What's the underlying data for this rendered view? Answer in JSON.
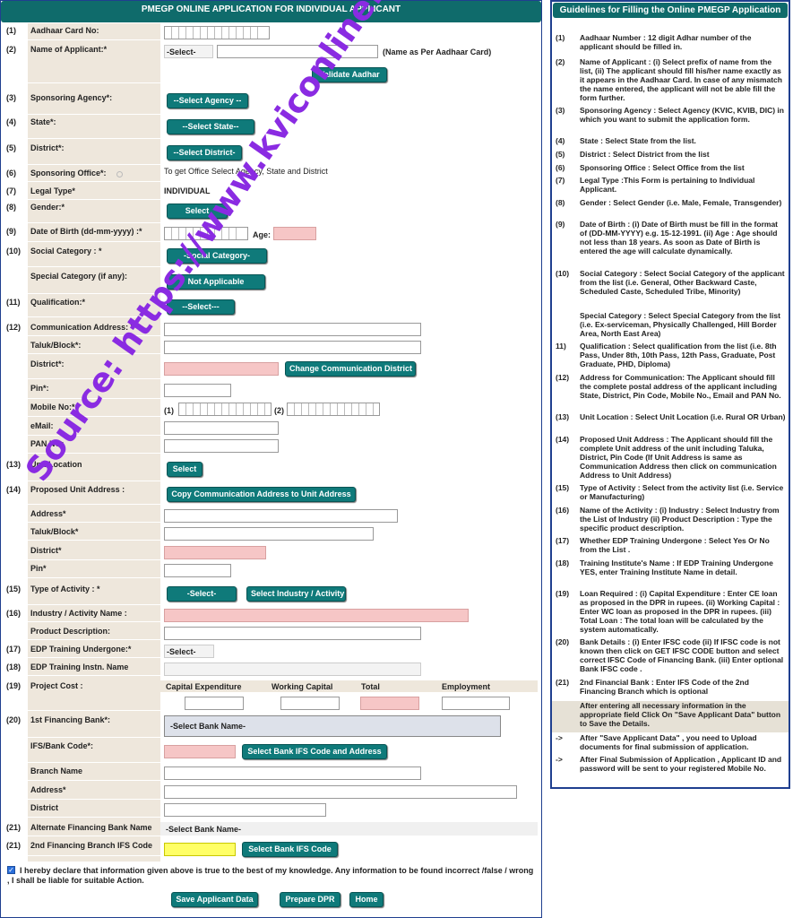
{
  "left": {
    "title": "PMEGP ONLINE APPLICATION FOR INDIVIDUAL APPLICANT",
    "rows": [
      {
        "n": "(1)",
        "label": "Aadhaar Card No:"
      },
      {
        "n": "(2)",
        "label": "Name of Applicant:*",
        "select": "-Select-",
        "note": "(Name as Per Aadhaar Card)"
      },
      {
        "n": "(3)",
        "label": "Sponsoring Agency*:",
        "select": "--Select Agency --"
      },
      {
        "n": "(4)",
        "label": "State*:",
        "select": "--Select State--"
      },
      {
        "n": "(5)",
        "label": "District*:",
        "select": "--Select District-"
      },
      {
        "n": "(6)",
        "label": "Sponsoring Office*:",
        "note": "To get Office Select Agency, State and District"
      },
      {
        "n": "(7)",
        "label": "Legal Type*",
        "value": "INDIVIDUAL"
      },
      {
        "n": "(8)",
        "label": "Gender:*",
        "select": "Select"
      },
      {
        "n": "(9)",
        "label": "Date of Birth (dd-mm-yyyy) :*",
        "age": "Age:"
      },
      {
        "n": "(10)",
        "label": "Social Category : *",
        "select": "-Social Category-"
      },
      {
        "n": "",
        "label": "Special Category (if any):",
        "select": "Not Applicable"
      },
      {
        "n": "(11)",
        "label": "Qualification:*",
        "select": "--Select---"
      },
      {
        "n": "(12)",
        "label": "Communication Address: *"
      },
      {
        "n": "",
        "label": "Taluk/Block*:"
      },
      {
        "n": "",
        "label": "District*:",
        "button": "Change Communication District"
      },
      {
        "n": "",
        "label": "Pin*:"
      },
      {
        "n": "",
        "label": "Mobile No:*:",
        "m1": "(1)",
        "m2": "(2)"
      },
      {
        "n": "",
        "label": "eMail:"
      },
      {
        "n": "",
        "label": "PAN NO:"
      },
      {
        "n": "(13)",
        "label": "Unit Location",
        "select": "Select"
      },
      {
        "n": "(14)",
        "label": "Proposed Unit Address :",
        "button": "Copy Communication Address to Unit Address"
      },
      {
        "n": "",
        "label": "Address*"
      },
      {
        "n": "",
        "label": "Taluk/Block*"
      },
      {
        "n": "",
        "label": "District*"
      },
      {
        "n": "",
        "label": "Pin*"
      },
      {
        "n": "(15)",
        "label": "Type of Activity : *",
        "select": "-Select-",
        "button": "Select Industry / Activity"
      },
      {
        "n": "(16)",
        "label": "Industry / Activity Name :"
      },
      {
        "n": "",
        "label": "Product Description:"
      },
      {
        "n": "(17)",
        "label": "EDP Training Undergone:*",
        "select": "-Select-"
      },
      {
        "n": "(18)",
        "label": "EDP Training Instn. Name"
      },
      {
        "n": "(19)",
        "label": "Project Cost :",
        "cols": [
          "Capital Expenditure",
          "Working Capital",
          "Total",
          "Employment"
        ]
      },
      {
        "n": "(20)",
        "label": "1st Financing Bank*:",
        "select": "-Select Bank Name-"
      },
      {
        "n": "",
        "label": "IFS/Bank Code*:",
        "button": "Select  Bank IFS Code and Address"
      },
      {
        "n": "",
        "label": "Branch Name"
      },
      {
        "n": "",
        "label": "Address*"
      },
      {
        "n": "",
        "label": "District"
      },
      {
        "n": "(21)",
        "label": "Alternate Financing Bank Name",
        "select": "-Select Bank Name-"
      },
      {
        "n": "(21)",
        "label": "2nd Financing Branch IFS Code",
        "button": "Select  Bank IFS Code"
      }
    ],
    "validate_btn": "Validate  Aadhar",
    "declaration": "I hereby declare that information given above is true to the best of my knowledge. Any information to be found incorrect /false / wrong , I shall be liable for suitable Action.",
    "buttons": {
      "save": "Save Applicant Data",
      "dpr": "Prepare DPR",
      "home": "Home"
    }
  },
  "right": {
    "title": "Guidelines for Filling the Online PMEGP Application",
    "items": [
      {
        "n": "(1)",
        "t": "Aadhaar Number : 12 digit Adhar number of the applicant should be filled in."
      },
      {
        "n": "(2)",
        "t": "Name of Applicant : (i) Select prefix of name from the list, (ii) The applicant should fill his/her name exactly as it appears in the Aadhaar Card. In case of any mismatch the name entered, the applicant will not be able fill the form further."
      },
      {
        "n": "(3)",
        "t": "Sponsoring Agency : Select Agency (KVIC, KVIB, DIC) in which you want to submit the application form."
      },
      {
        "n": "(4)",
        "t": "State : Select State from the list."
      },
      {
        "n": "(5)",
        "t": "District : Select District from the list"
      },
      {
        "n": "(6)",
        "t": "Sponsoring Office : Select Office from the list"
      },
      {
        "n": "(7)",
        "t": "Legal Type :This Form is pertaining to Individual Applicant."
      },
      {
        "n": "(8)",
        "t": "Gender : Select Gender (i.e. Male, Female, Transgender)"
      },
      {
        "n": "(9)",
        "t": "Date of Birth : (i) Date of Birth must be fill in the format of (DD-MM-YYYY) e.g. 15-12-1991. (ii) Age : Age should not less than 18 years. As soon as Date of Birth is entered the age will calculate dynamically."
      },
      {
        "n": "(10)",
        "t": "Social Category : Select Social Category of the applicant from the list (i.e. General, Other Backward Caste, Scheduled Caste, Scheduled Tribe, Minority)"
      },
      {
        "n": "",
        "t": "Special Category : Select Special Category from the list (i.e. Ex-serviceman, Physically Challenged, Hill Border Area, North East Area)"
      },
      {
        "n": "11)",
        "t": "Qualification : Select qualification from the list (i.e. 8th Pass, Under 8th, 10th Pass, 12th Pass, Graduate, Post Graduate, PHD, Diploma)"
      },
      {
        "n": "(12)",
        "t": "Address for Communication: The Applicant should fill the complete postal address of the applicant including State, District, Pin Code, Mobile No., Email and PAN No."
      },
      {
        "n": "(13)",
        "t": "Unit Location : Select Unit Location (i.e. Rural OR Urban)"
      },
      {
        "n": "(14)",
        "t": "Proposed Unit Address : The Applicant should fill the complete Unit address of the unit including Taluka, District, Pin Code (If Unit Address is same as Communication Address then click on communication Address to Unit Address)"
      },
      {
        "n": "(15)",
        "t": "Type of Activity : Select from the activity list (i.e. Service or Manufacturing)"
      },
      {
        "n": "(16)",
        "t": "Name of the Activity : (i) Industry : Select Industry from the List of Industry (ii) Product Description : Type the specific product description."
      },
      {
        "n": "(17)",
        "t": "Whether EDP Training Undergone : Select Yes Or No from the List ."
      },
      {
        "n": "(18)",
        "t": "Training Institute's Name : If EDP Training Undergone YES, enter Training Institute Name in detail."
      },
      {
        "n": "(19)",
        "t": "Loan Required : (i) Capital Expenditure : Enter CE loan as proposed in the DPR in rupees. (ii) Working Capital : Enter WC loan as proposed in the DPR in rupees. (iii) Total Loan : The total loan will be calculated by the system automatically."
      },
      {
        "n": "(20)",
        "t": "Bank Details : (i) Enter IFSC code (ii) If IFSC code is not known then click on GET IFSC CODE button and select correct IFSC Code of Financing Bank. (iii) Enter optional Bank IFSC code ."
      },
      {
        "n": "(21)",
        "t": "2nd Financial Bank : Enter IFS Code of the 2nd Financing Branch which is optional"
      },
      {
        "n": "",
        "t": "After entering all necessary information in the appropriate field Click On \"Save Applicant Data\" button to Save the Details."
      },
      {
        "n": "->",
        "t": "After \"Save Applicant Data\" , you need to Upload documents for final submission of application."
      },
      {
        "n": "->",
        "t": "After Final Submission of Application , Applicant ID and password will be sent to your registered Mobile No."
      }
    ]
  },
  "watermark": "Source: https://www.kviconline.gov.in/pmegpeportal/jsp/pmegponline.jsp"
}
